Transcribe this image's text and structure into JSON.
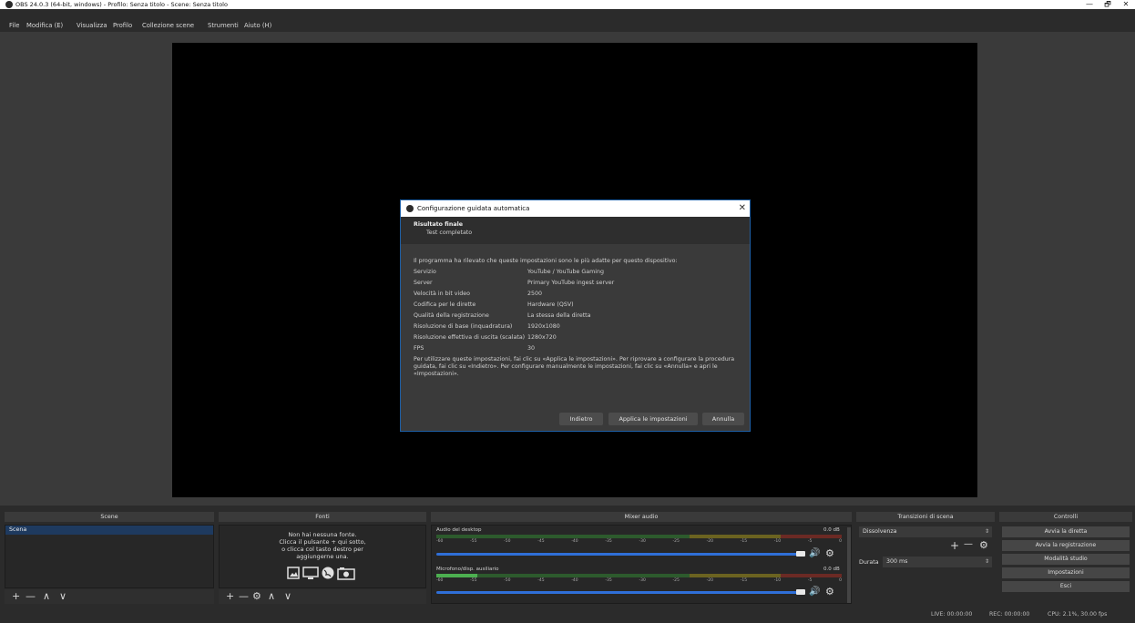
{
  "window": {
    "title": "OBS 24.0.3 (64-bit, windows) - Profilo: Senza titolo - Scene: Senza titolo",
    "minimize": "—",
    "maximize": "🗗",
    "close": "✕"
  },
  "menu": [
    "File",
    "Modifica (E)",
    "Visualizza",
    "Profilo",
    "Collezione scene",
    "Strumenti",
    "Aiuto (H)"
  ],
  "dialog": {
    "title": "Configurazione guidata automatica",
    "close": "✕",
    "heading": "Risultato finale",
    "subheading": "Test completato",
    "intro": "Il programma ha rilevato che queste impostazioni sono le più adatte per questo dispositivo:",
    "rows": [
      {
        "label": "Servizio",
        "value": "YouTube / YouTube Gaming"
      },
      {
        "label": "Server",
        "value": "Primary YouTube ingest server"
      },
      {
        "label": "Velocità in bit video",
        "value": "2500"
      },
      {
        "label": "Codifica per le dirette",
        "value": "Hardware (QSV)"
      },
      {
        "label": "Qualità della registrazione",
        "value": "La stessa della diretta"
      },
      {
        "label": "Risoluzione di base (inquadratura)",
        "value": "1920x1080"
      },
      {
        "label": "Risoluzione effettiva di uscita (scalata)",
        "value": "1280x720"
      },
      {
        "label": "FPS",
        "value": "30"
      }
    ],
    "note_line1": "Per utilizzare queste impostazioni, fai clic su «Applica le impostazioni». Per riprovare a configurare la procedura",
    "note_line2": "guidata, fai clic su «Indietro». Per configurare manualmente le impostazioni, fai clic su «Annulla» e apri le",
    "note_line3": "«Impostazioni».",
    "buttons": {
      "back": "Indietro",
      "apply": "Applica le impostazioni",
      "cancel": "Annulla"
    }
  },
  "scenes": {
    "header": "Scene",
    "items": [
      "Scena"
    ],
    "toolbar": {
      "add": "+",
      "remove": "—",
      "up": "∧",
      "down": "∨"
    }
  },
  "sources": {
    "header": "Fonti",
    "empty_line1": "Non hai nessuna fonte.",
    "empty_line2": "Clicca il pulsante + qui sotto,",
    "empty_line3": "o clicca col tasto destro per",
    "empty_line4": "aggiungerne una.",
    "toolbar": {
      "add": "+",
      "remove": "—",
      "settings": "⚙",
      "up": "∧",
      "down": "∨"
    }
  },
  "mixer": {
    "header": "Mixer audio",
    "tracks": [
      {
        "name": "Audio del desktop",
        "db": "0.0 dB",
        "level": 0.0
      },
      {
        "name": "Microfono/disp. ausiliario",
        "db": "0.0 dB",
        "level": 0.1
      }
    ],
    "ticks": [
      "-60",
      "-55",
      "-50",
      "-45",
      "-40",
      "-35",
      "-30",
      "-25",
      "-20",
      "-15",
      "-10",
      "-5",
      "0"
    ]
  },
  "transitions": {
    "header": "Transizioni di scena",
    "selected": "Dissolvenza",
    "duration_label": "Durata",
    "duration_value": "300 ms",
    "add": "+",
    "remove": "—"
  },
  "controls": {
    "header": "Controlli",
    "buttons": [
      "Avvia la diretta",
      "Avvia la registrazione",
      "Modalità studio",
      "Impostazioni",
      "Esci"
    ]
  },
  "status": {
    "live": "LIVE: 00:00:00",
    "rec": "REC: 00:00:00",
    "cpu": "CPU: 2.1%, 30.00 fps"
  },
  "colors": {
    "accent": "#1e5fa5",
    "meter_green": "#4caf50",
    "meter_yellow": "#c8b400",
    "meter_red": "#c0392b",
    "volume_blue": "#2f6fd8"
  }
}
